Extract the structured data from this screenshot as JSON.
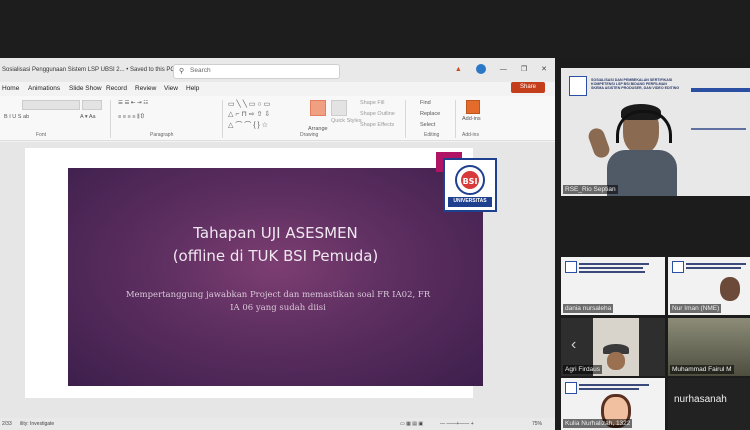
{
  "window": {
    "doc_title": "Sosialisasi Penggunaan Sistem LSP UBSI 2... • Saved to this PC ▾",
    "search_placeholder": "Search"
  },
  "ribbon": {
    "tabs": [
      "Home",
      "Animations",
      "Slide Show",
      "Record",
      "Review",
      "View",
      "Help"
    ],
    "share_label": "Share",
    "groups": {
      "font": "Font",
      "paragraph": "Paragraph",
      "drawing": "Drawing",
      "editing": "Editing",
      "addin": "Add-ins"
    },
    "items": {
      "arrange": "Arrange",
      "quick_styles": "Quick Styles",
      "shape_fill": "Shape Fill",
      "shape_outline": "Shape Outline",
      "shape_effects": "Shape Effects",
      "find": "Find",
      "replace": "Replace",
      "select": "Select",
      "addins": "Add-ins"
    }
  },
  "slide": {
    "title_line1": "Tahapan UJI ASESMEN",
    "title_line2": "(offline di TUK BSI Pemuda)",
    "body_line1": "Mempertanggung jawabkan Project dan  memastikan soal FR IA02, FR",
    "body_line2": "IA 06 yang sudah diisi",
    "logo_text": "UNIVERSITAS"
  },
  "status": {
    "left_text": "2/33",
    "accessibility": "ility: Investigate",
    "zoom": "75%"
  },
  "participants": [
    {
      "name": "RSE_Rio Septian"
    },
    {
      "name": "dania nursaleha"
    },
    {
      "name": "Nur Iman (NME)"
    },
    {
      "name": "Agri Firdaus"
    },
    {
      "name": "Muhammad Fairul M"
    },
    {
      "name": "Kulia Nurhalizah, 1322"
    },
    {
      "name": "nurhasanah"
    }
  ],
  "speaker_banner": {
    "line1": "SOSIALISASI DAN PEMBEKALAN SERTIFIKASI",
    "line2": "KOMPETENSI LSP BSI BIDANG PERFILMAN",
    "line3": "SKEMA ASISTEN PRODUSER, DAN VIDEO EDITING"
  },
  "colors": {
    "share": "#c43e1c",
    "slide_purple": "#5e2f61",
    "logo_blue": "#1f3f8f",
    "logo_magenta": "#b01565"
  }
}
